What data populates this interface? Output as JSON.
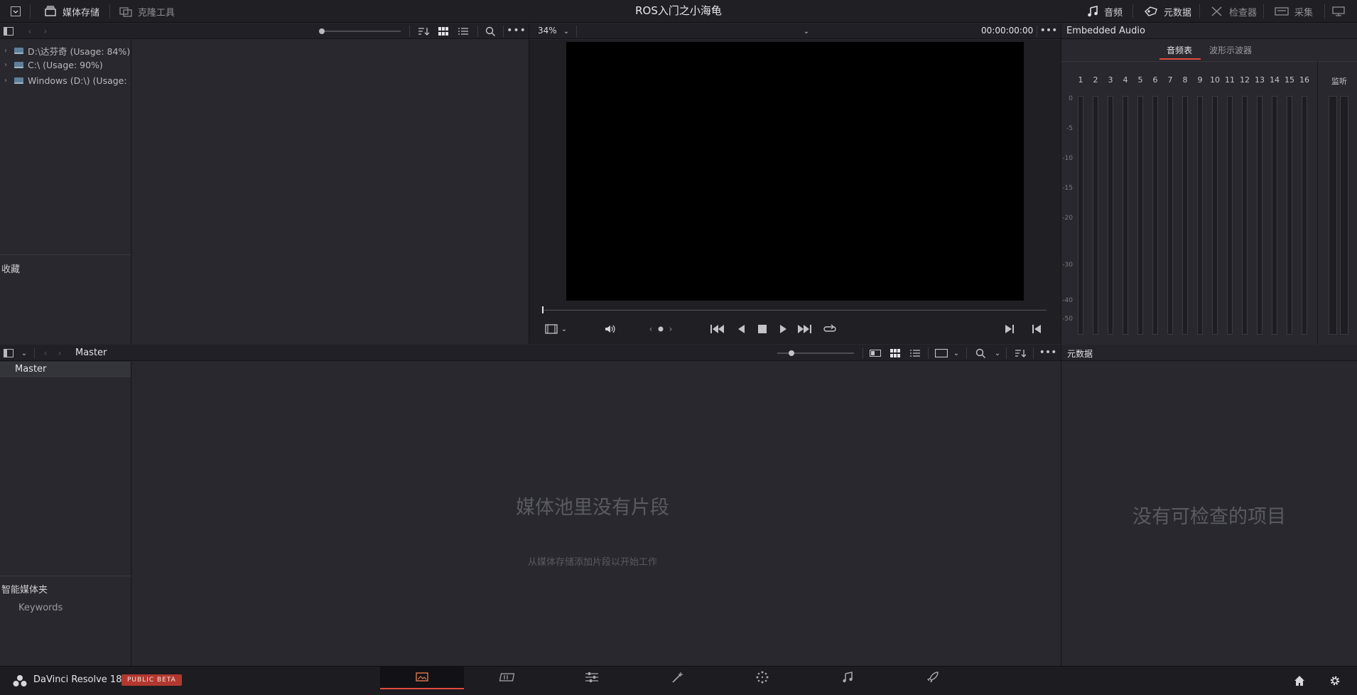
{
  "topbar": {
    "media_storage": "媒体存储",
    "clone_tool": "克隆工具",
    "title": "ROS入门之小海龟",
    "audio": "音频",
    "metadata": "元数据",
    "inspector": "检查器",
    "capture": "采集"
  },
  "media_storage": {
    "drives": [
      "D:\\达芬奇 (Usage: 84%)",
      "C:\\ (Usage: 90%)",
      "Windows (D:\\) (Usage: ..."
    ],
    "favorites_label": "收藏"
  },
  "viewer": {
    "zoom": "34%",
    "timecode": "00:00:00:00"
  },
  "audio_panel": {
    "title": "Embedded Audio",
    "tabs": [
      "音频表",
      "波形示波器"
    ],
    "channels": [
      "1",
      "2",
      "3",
      "4",
      "5",
      "6",
      "7",
      "8",
      "9",
      "10",
      "11",
      "12",
      "13",
      "14",
      "15",
      "16"
    ],
    "monitor_label": "监听",
    "db_scale": [
      "0",
      "-5",
      "-10",
      "-15",
      "-20",
      "-30",
      "-40",
      "-50"
    ]
  },
  "media_pool": {
    "bin_title": "Master",
    "bins": [
      "Master"
    ],
    "smart_bins_label": "智能媒体夹",
    "smart_bins": [
      "Keywords"
    ],
    "empty_title": "媒体池里没有片段",
    "empty_hint": "从媒体存储添加片段以开始工作"
  },
  "metadata_panel": {
    "title": "元数据",
    "empty": "没有可检查的项目"
  },
  "bottombar": {
    "app_name": "DaVinci Resolve 18",
    "badge": "PUBLIC BETA"
  },
  "colors": {
    "accent_red": "#e0493e",
    "badge_bg": "#b2382f",
    "background": "#28282e"
  }
}
